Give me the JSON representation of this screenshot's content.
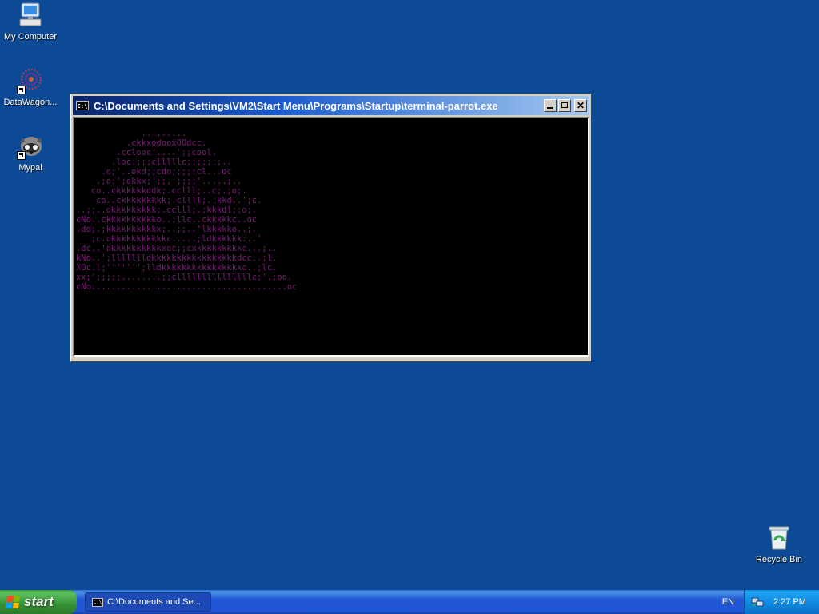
{
  "desktop": {
    "icons": [
      {
        "label": "My Computer",
        "icon": "my-computer-icon"
      },
      {
        "label": "DataWagon...",
        "icon": "datawagon-shortcut-icon"
      },
      {
        "label": "Mypal",
        "icon": "mypal-shortcut-icon"
      },
      {
        "label": "Recycle Bin",
        "icon": "recycle-bin-icon"
      }
    ],
    "background_color": "#0c4a96"
  },
  "window": {
    "title": "C:\\Documents and Settings\\VM2\\Start Menu\\Programs\\Startup\\terminal-parrot.exe",
    "app_icon_text": "C:\\",
    "console_color": "#7a1e78",
    "console_lines": [
      "             .........",
      "          .ckkxodooxOOdcc.",
      "        .cclooc'....';;cool.",
      "       .loc;;;;clllllc;;;;;;;..",
      "     .c;'..okd;;cdo;;;;;cl...oc",
      "    .;o;';okkx;';;,';;;;'.....;..",
      "   co..ckkkkkkddk;.cclll;..c;.;o;.",
      "    co..ckkkkkkkkk;.cllll;.;kkd..';c.",
      "..;;..okkkkkkkkk;.cclll;.;kkkdl;;o;.",
      "cNo..ckkkkkkkkkko..;llc..ckkkkkc..oc",
      ".dd;.;kkkkkkkkkkx;..;;..'lkkkkko..;.",
      "   ;c.ckkkkkkkkkkkc.....;ldkkkkkk:..'",
      ".dc..'okkkkkkkkkkxoc;;cxkkkkkkkkkc...;..",
      "kNo..';llllllldkkkkkkkkkkkkkkkkkdcc..;l.",
      "XOc.l;''''''';lldkkkkkkkkkkkkkkkkc..;lc.",
      "xx;';;;;;........;;clllllllllllllllc;'.;oo.",
      "cNo.......................................oc"
    ]
  },
  "taskbar": {
    "start_label": "start",
    "task_label": "C:\\Documents and Se...",
    "task_icon_text": "C:\\",
    "language": "EN",
    "time": "2:27 PM"
  }
}
